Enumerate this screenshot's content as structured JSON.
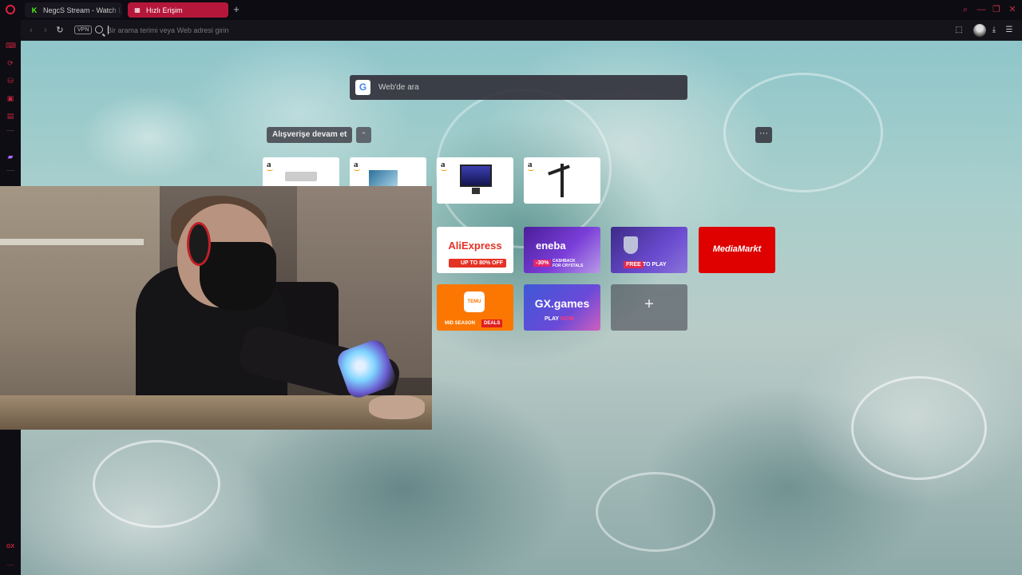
{
  "tabs": [
    {
      "title": "NegcS Stream - Watch Live on Kick",
      "active": false,
      "favicon": "kick-icon"
    },
    {
      "title": "Hızlı Erişim",
      "active": true,
      "favicon": "grid-icon"
    }
  ],
  "addressbar": {
    "vpn_label": "VPN",
    "placeholder": "Bir arama terimi veya Web adresi girin"
  },
  "search": {
    "placeholder": "Web'de ara",
    "engine_letter": "G"
  },
  "speeddial": {
    "shopping_label": "Alışverişe devam et",
    "amazon_letter": "a",
    "aliexpress": {
      "brand": "AliExpress",
      "promo": "UP TO 80% OFF"
    },
    "eneba": {
      "brand": "eneba",
      "badge": "-30%",
      "sub": "CASHBACK FOR CRYSTALS"
    },
    "wot": {
      "free": "FREE",
      "play": "TO PLAY"
    },
    "mediamarkt": {
      "brand": "MediaMarkt"
    },
    "temu": {
      "logo": "TEMU",
      "season": "MID SEASON",
      "deals": "DEALS"
    },
    "gx": {
      "brand": "GX.games",
      "play": "PLAY",
      "now": "NOW"
    },
    "add_label": "+",
    "more_label": "···"
  },
  "sidebar": {
    "gx_label": "GX"
  },
  "colors": {
    "accent": "#e0213f",
    "active_tab": "#b5173a",
    "background": "#0b0a10"
  }
}
